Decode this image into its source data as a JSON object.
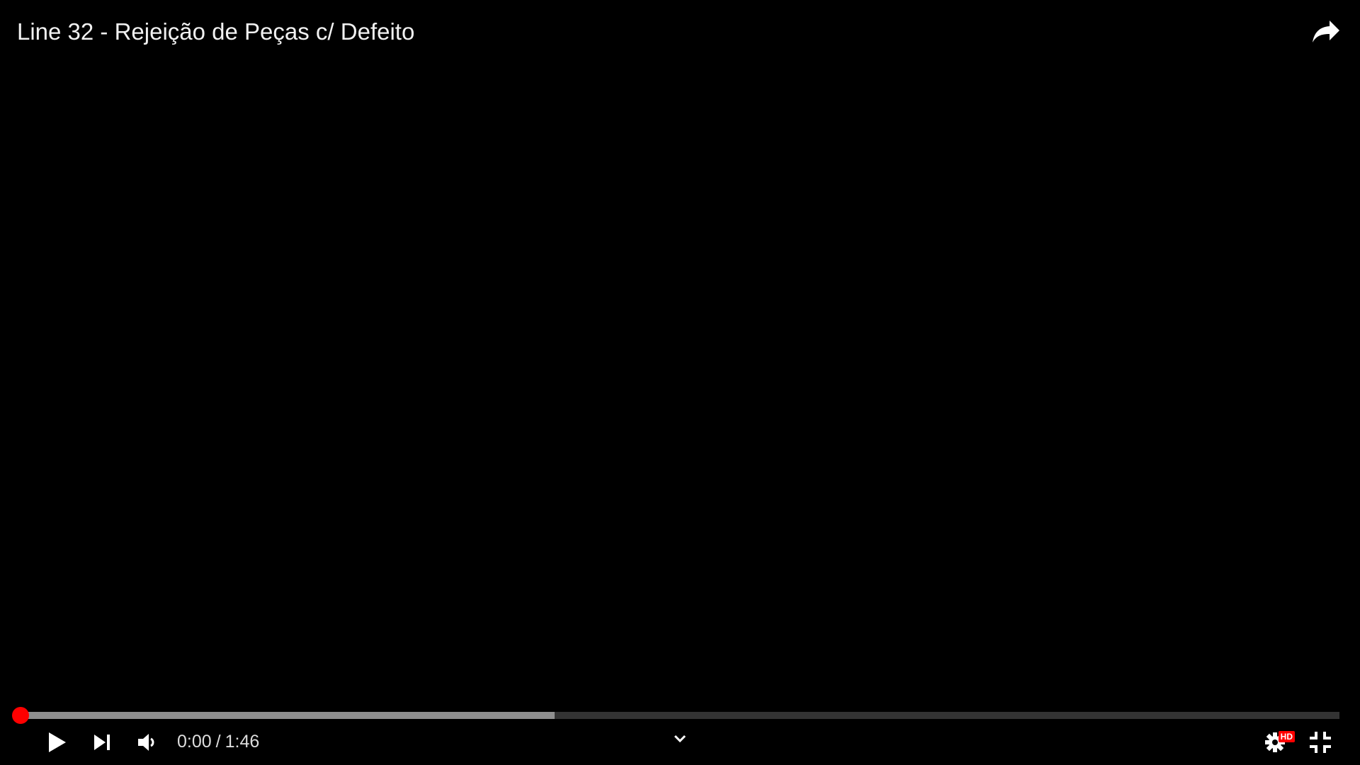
{
  "video": {
    "title": "Line 32 - Rejeição de Peças c/ Defeito"
  },
  "time": {
    "current": "0:00",
    "separator": "/",
    "duration": "1:46"
  },
  "progress": {
    "played_fraction": 0,
    "buffered_fraction": 0.405
  },
  "settings": {
    "quality_badge": "HD"
  },
  "colors": {
    "accent": "#ff0000",
    "background": "#000000",
    "text": "#f1f1f1"
  },
  "icons": {
    "share": "share-icon",
    "play": "play-icon",
    "next": "next-icon",
    "volume": "volume-icon",
    "chevron": "chevron-down-icon",
    "settings": "gear-icon",
    "fullscreen_exit": "exit-fullscreen-icon"
  }
}
